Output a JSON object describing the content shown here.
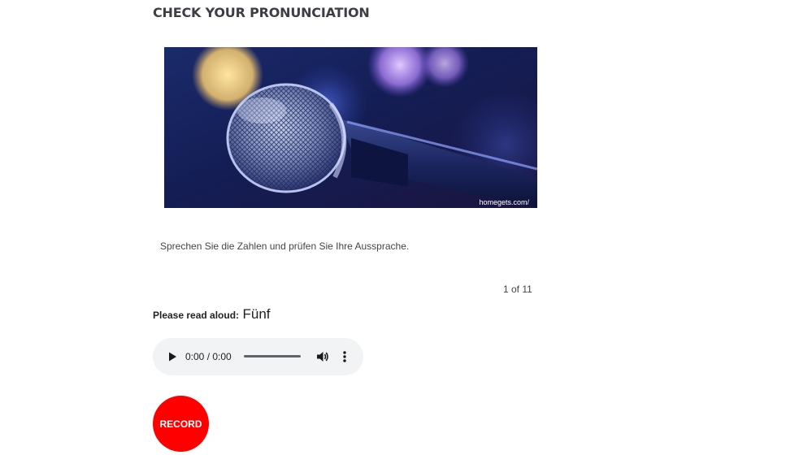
{
  "section": {
    "title": "CHECK YOUR PRONUNCIATION"
  },
  "image": {
    "credit": "homegets.com/"
  },
  "instruction": "Sprechen Sie die Zahlen und prüfen Sie Ihre Aussprache.",
  "counter": {
    "text": "1 of 11"
  },
  "prompt": {
    "label": "Please read aloud:",
    "word": "Fünf"
  },
  "audio_player": {
    "time": "0:00 / 0:00",
    "progress": 0,
    "play_icon": "play-icon",
    "volume_icon": "volume-icon",
    "more_icon": "more-vertical-icon"
  },
  "record_button": {
    "label": "RECORD",
    "color": "#ff0000"
  }
}
